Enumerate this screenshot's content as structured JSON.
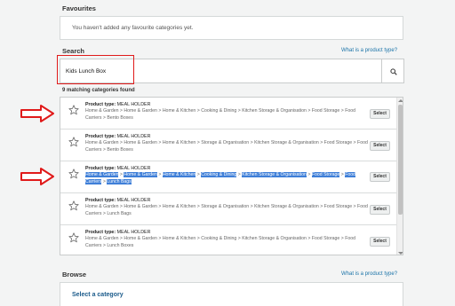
{
  "favourites": {
    "title": "Favourites",
    "empty_message": "You haven't added any favourite categories yet."
  },
  "search": {
    "title": "Search",
    "help_link": "What is a product type?",
    "value": "Kids Lunch Box",
    "match_count_label": "9 matching categories found"
  },
  "results": [
    {
      "type_label": "Product type:",
      "type_value": "MEAL HOLDER",
      "path": [
        "Home & Garden",
        "Home & Garden",
        "Home & Kitchen",
        "Cooking & Dining",
        "Kitchen Storage & Organisation",
        "Food Storage",
        "Food Carriers",
        "Bento Boxes"
      ],
      "select_label": "Select",
      "highlighted": false
    },
    {
      "type_label": "Product type:",
      "type_value": "MEAL HOLDER",
      "path": [
        "Home & Garden",
        "Home & Garden",
        "Home & Kitchen",
        "Storage & Organisation",
        "Kitchen Storage & Organisation",
        "Food Storage",
        "Food Carriers",
        "Bento Boxes"
      ],
      "select_label": "Select",
      "highlighted": false
    },
    {
      "type_label": "Product type:",
      "type_value": "MEAL HOLDER",
      "path": [
        "Home & Garden",
        "Home & Garden",
        "Home & Kitchen",
        "Cooking & Dining",
        "Kitchen Storage & Organisation",
        "Food Storage",
        "Food Carriers",
        "Lunch Bags"
      ],
      "select_label": "Select",
      "highlighted": true
    },
    {
      "type_label": "Product type:",
      "type_value": "MEAL HOLDER",
      "path": [
        "Home & Garden",
        "Home & Garden",
        "Home & Kitchen",
        "Storage & Organisation",
        "Kitchen Storage & Organisation",
        "Food Storage",
        "Food Carriers",
        "Lunch Bags"
      ],
      "select_label": "Select",
      "highlighted": false
    },
    {
      "type_label": "Product type:",
      "type_value": "MEAL HOLDER",
      "path": [
        "Home & Garden",
        "Home & Garden",
        "Home & Kitchen",
        "Cooking & Dining",
        "Kitchen Storage & Organisation",
        "Food Storage",
        "Food Carriers",
        "Lunch Boxes"
      ],
      "select_label": "Select",
      "highlighted": false
    }
  ],
  "browse": {
    "title": "Browse",
    "help_link": "What is a product type?",
    "select_category": "Select a category"
  },
  "colors": {
    "annotation_red": "#e01a1a",
    "link_blue": "#1a73a8",
    "highlight_blue": "#3f7fd8"
  },
  "icons": {
    "search": "search-icon",
    "star": "star-outline-icon",
    "annotation_arrow": "red-arrow-icon"
  }
}
